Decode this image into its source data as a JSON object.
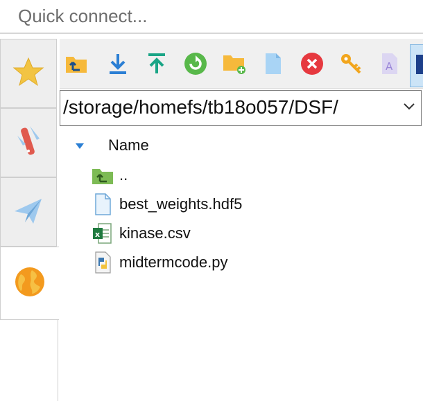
{
  "quick_connect": {
    "placeholder": "Quick connect..."
  },
  "sidebar": {
    "tabs": [
      {
        "name": "favorites",
        "icon": "star-icon"
      },
      {
        "name": "tools",
        "icon": "pocket-knife-icon"
      },
      {
        "name": "transfers",
        "icon": "paper-plane-icon"
      },
      {
        "name": "sessions",
        "icon": "globe-icon",
        "active": true
      }
    ]
  },
  "toolbar": {
    "buttons": [
      {
        "icon": "parent-folder-icon"
      },
      {
        "icon": "download-icon"
      },
      {
        "icon": "upload-icon"
      },
      {
        "icon": "refresh-icon"
      },
      {
        "icon": "new-folder-icon"
      },
      {
        "icon": "new-file-icon"
      },
      {
        "icon": "delete-icon"
      },
      {
        "icon": "permissions-key-icon"
      },
      {
        "icon": "rename-icon"
      },
      {
        "icon": "more-icon"
      }
    ]
  },
  "path_bar": {
    "value": "/storage/homefs/tb18o057/DSF/"
  },
  "file_list": {
    "header": {
      "name_label": "Name",
      "sort": "ascending"
    },
    "rows": [
      {
        "name": "..",
        "type": "parent-directory",
        "icon": "parent-folder-icon"
      },
      {
        "name": "best_weights.hdf5",
        "type": "file",
        "icon": "file-icon"
      },
      {
        "name": "kinase.csv",
        "type": "csv",
        "icon": "excel-csv-icon"
      },
      {
        "name": "midtermcode.py",
        "type": "python",
        "icon": "python-icon"
      }
    ]
  },
  "colors": {
    "accent_blue": "#2b7fd4",
    "toolbar_bg": "#f0f0f0",
    "sidebar_tab_bg": "#eeeeee"
  }
}
